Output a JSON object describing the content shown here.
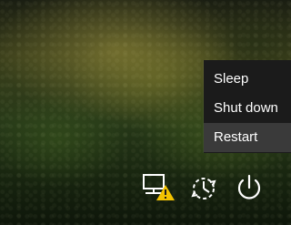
{
  "power_menu": {
    "items": [
      {
        "label": "Sleep"
      },
      {
        "label": "Shut down"
      },
      {
        "label": "Restart"
      }
    ],
    "highlighted": "Restart"
  },
  "icons": {
    "network": "network-warning-icon",
    "ease_of_access": "ease-of-access-icon",
    "power": "power-icon"
  },
  "colors": {
    "menu_bg": "#1b1b1b",
    "menu_highlight": "#3a3a3a",
    "icon": "#ffffff",
    "warning": "#f2c200"
  }
}
